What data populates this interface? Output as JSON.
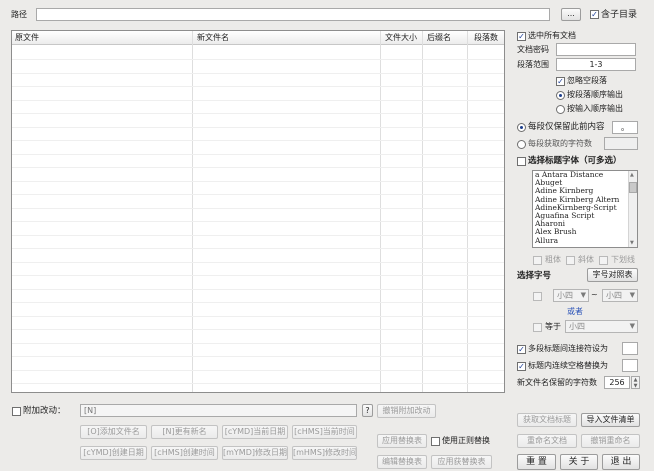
{
  "path": {
    "label": "路径",
    "value": "",
    "browse_label": "..."
  },
  "subdir": {
    "label": "含子目录",
    "checked": true
  },
  "table": {
    "columns": [
      "原文件",
      "新文件名",
      "文件大小",
      "后缀名",
      "段落数"
    ],
    "rows": []
  },
  "options": {
    "select_all_docs": {
      "label": "选中所有文档",
      "checked": true
    },
    "doc_password": {
      "label": "文档密码",
      "value": ""
    },
    "para_range": {
      "label": "段落范围",
      "value": "1-3"
    },
    "ignore_empty": {
      "label": "忽略空段落",
      "checked": true
    },
    "order_para": {
      "label": "按段落顺序输出",
      "selected": true
    },
    "order_input": {
      "label": "按输入顺序输出",
      "selected": false
    },
    "keep_before": {
      "label": "每段仅保留此前内容",
      "value": "。",
      "selected": true
    },
    "char_count": {
      "label": "每段获取的字符数",
      "value": "",
      "selected": false
    },
    "heading_font": {
      "label": "选择标题字体（可多选）",
      "checked": false
    },
    "fonts": [
      "a Antara Distance",
      "Abuget",
      "Adine Kirnberg",
      "Adine Kirnberg Altern",
      "AdineKirnberg-Script",
      "Aguafina Script",
      "Aharoni",
      "Alex Brush",
      "Allura"
    ],
    "bold": "粗体",
    "italic": "斜体",
    "underline": "下划线",
    "size_title": "选择字号",
    "size_table_btn": "字号对照表",
    "size_from": "小四",
    "size_tilde": "~",
    "size_to": "小四",
    "or_label": "或者",
    "equal_label": "等于",
    "equal_value": "小四",
    "multi_heading": {
      "label": "多段标题间连接符设为",
      "checked": true
    },
    "heading_space": {
      "label": "标题内连续空格替换为",
      "checked": true
    },
    "max_chars": {
      "label": "新文件名保留的字符数",
      "value": "256"
    }
  },
  "bottom": {
    "append_label": "附加改动：",
    "append_checked": false,
    "input_value": "[N]",
    "question_label": "?",
    "clear_btn": "撤销附加改动",
    "tags_row1": [
      "[O]添加文件名",
      "[N]更有新名",
      "[cYMD]当前日期",
      "[cHMS]当前时间"
    ],
    "tags_row2": [
      "[cYMD]创建日期",
      "[cHMS]创建时间",
      "[mYMD]修改日期",
      "[mHMS]修改时间"
    ],
    "apply_replace": "应用替换表",
    "use_regex": "使用正则替换",
    "edit_replace": "编辑替换表",
    "apply_replace2": "应用获替换表"
  },
  "actions": {
    "get_title": "获取文档标题",
    "import_list": "导入文件清单",
    "rename_doc": "重命名文档",
    "undo_rename": "撤销重命名",
    "reset": "重 置",
    "about": "关 于",
    "exit": "退 出"
  },
  "colors": {
    "window_bg": "#ecebe9",
    "check_mark": "#1e3f99",
    "accent_text": "#2b53b8"
  }
}
